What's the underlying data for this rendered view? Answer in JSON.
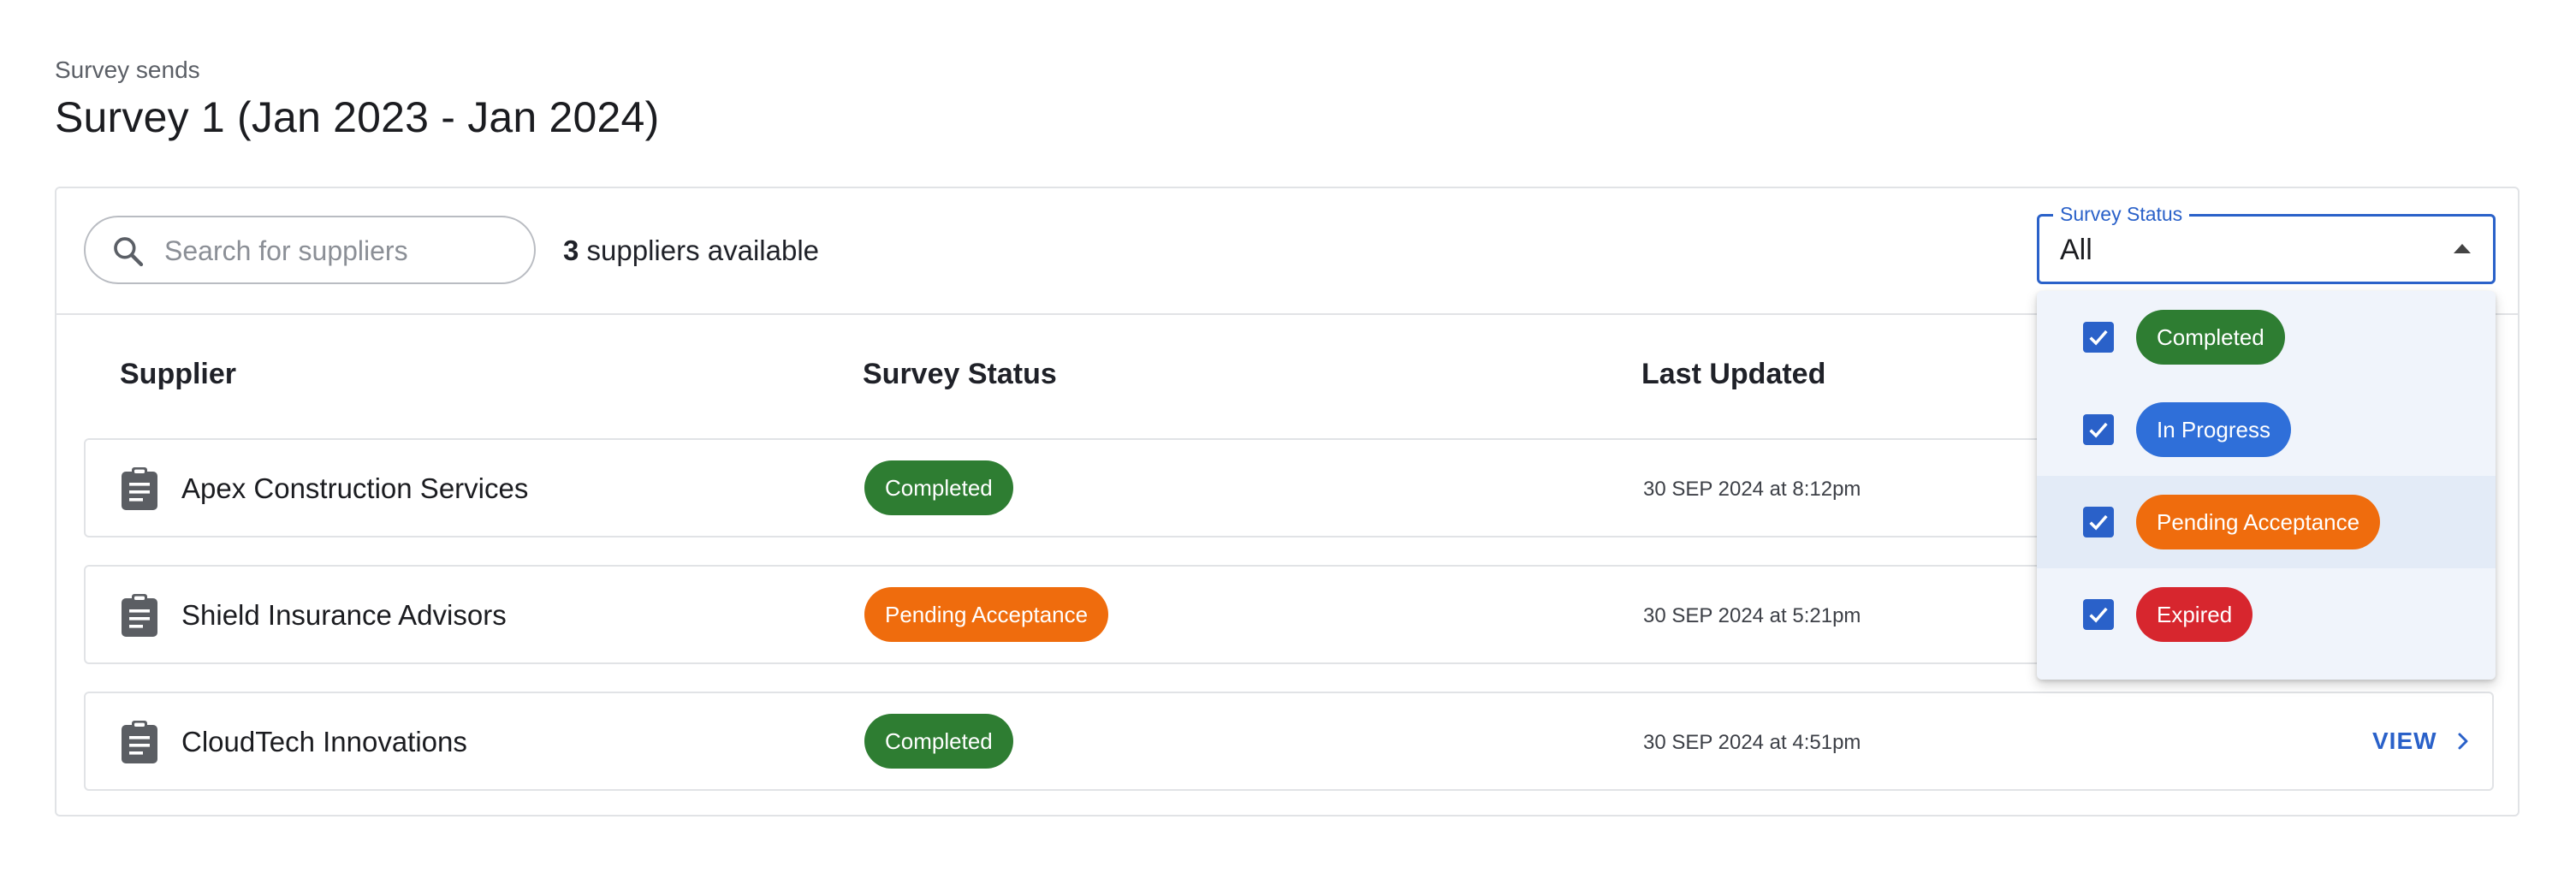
{
  "breadcrumb": "Survey sends",
  "title": "Survey 1 (Jan 2023 - Jan 2024)",
  "search": {
    "placeholder": "Search for suppliers",
    "icon": "search-icon"
  },
  "count": {
    "number": "3",
    "label": " suppliers available"
  },
  "columns": {
    "supplier": "Supplier",
    "status": "Survey Status",
    "updated": "Last Updated"
  },
  "rows": [
    {
      "name": "Apex Construction Services",
      "status": "Completed",
      "updated": "30 SEP 2024 at 8:12pm"
    },
    {
      "name": "Shield Insurance Advisors",
      "status": "Pending Acceptance",
      "updated": "30 SEP 2024 at 5:21pm"
    },
    {
      "name": "CloudTech Innovations",
      "status": "Completed",
      "updated": "30 SEP 2024 at 4:51pm",
      "view": "VIEW"
    }
  ],
  "filter": {
    "label": "Survey Status",
    "value": "All",
    "options": [
      {
        "label": "Completed",
        "checked": true
      },
      {
        "label": "In Progress",
        "checked": true
      },
      {
        "label": "Pending Acceptance",
        "checked": true
      },
      {
        "label": "Expired",
        "checked": true
      }
    ]
  },
  "colors": {
    "accent": "#2a61c9",
    "completed": "#2e7d32",
    "in_progress": "#2f6fd9",
    "pending": "#ef6c0d",
    "expired": "#d7262e"
  }
}
